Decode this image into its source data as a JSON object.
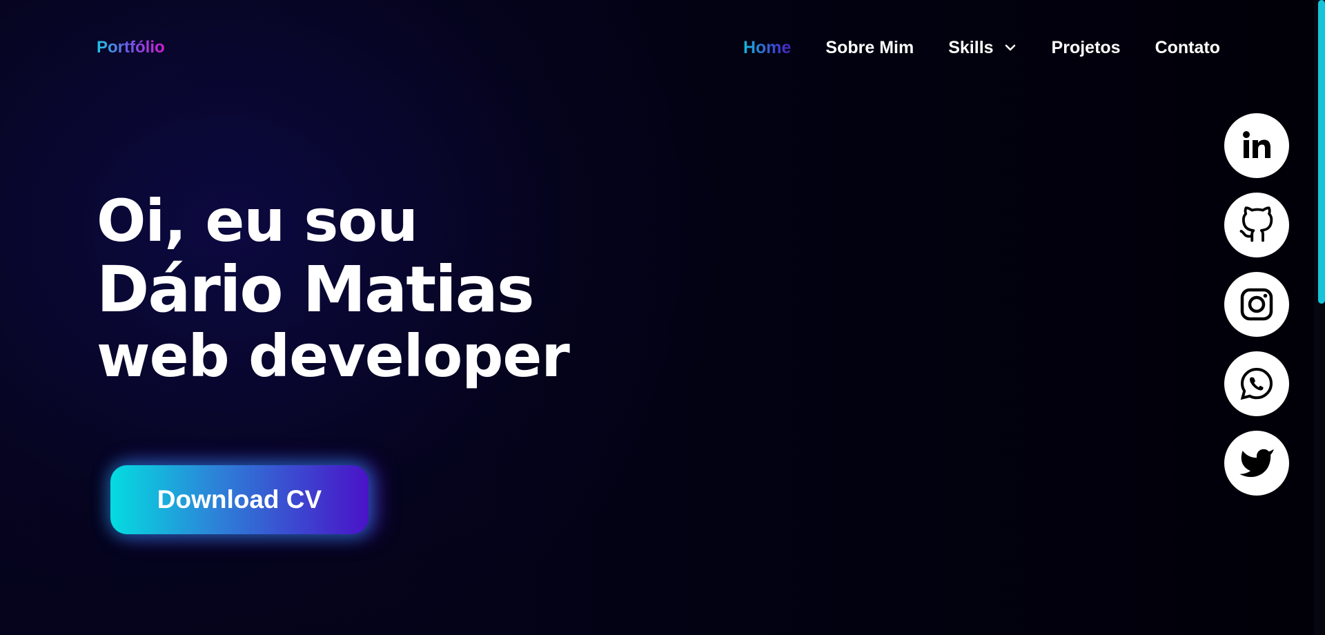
{
  "brand": {
    "name": "Portfólio"
  },
  "nav": {
    "items": [
      {
        "label": "Home",
        "active": true
      },
      {
        "label": "Sobre Mim",
        "active": false
      },
      {
        "label": "Skills",
        "active": false,
        "dropdown": true
      },
      {
        "label": "Projetos",
        "active": false
      },
      {
        "label": "Contato",
        "active": false
      }
    ]
  },
  "hero": {
    "greeting": "Oi, eu sou",
    "name": "Dário Matias",
    "role": "web developer"
  },
  "cta": {
    "label": "Download CV"
  },
  "social": [
    {
      "icon": "linkedin-icon"
    },
    {
      "icon": "github-icon"
    },
    {
      "icon": "instagram-icon"
    },
    {
      "icon": "whatsapp-icon"
    },
    {
      "icon": "twitter-icon"
    }
  ],
  "colors": {
    "accent_cyan": "#04dce0",
    "accent_purple": "#4a12c8",
    "brand_magenta": "#d91ad6",
    "background": "#030210",
    "scroll_thumb": "#17c3d8"
  }
}
